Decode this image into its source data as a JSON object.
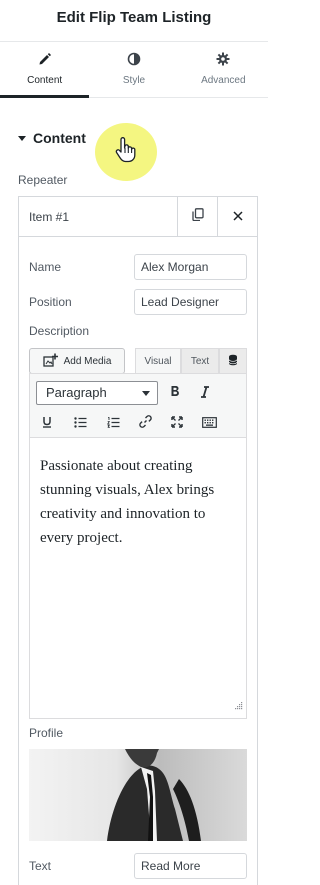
{
  "header": {
    "title": "Edit Flip Team Listing"
  },
  "tabs": [
    {
      "label": "Content",
      "icon": "pencil-icon",
      "active": true
    },
    {
      "label": "Style",
      "icon": "contrast-icon",
      "active": false
    },
    {
      "label": "Advanced",
      "icon": "gear-icon",
      "active": false
    }
  ],
  "section": {
    "title": "Content"
  },
  "repeater": {
    "label": "Repeater",
    "item": {
      "title": "Item #1",
      "fields": {
        "name": {
          "label": "Name",
          "value": "Alex Morgan"
        },
        "position": {
          "label": "Position",
          "value": "Lead Designer"
        },
        "description": {
          "label": "Description",
          "add_media": "Add Media",
          "tab_visual": "Visual",
          "tab_text": "Text",
          "format": "Paragraph",
          "content": "Passionate about creating stunning visuals, Alex brings creativity and innovation to every project."
        },
        "profile": {
          "label": "Profile"
        },
        "text": {
          "label": "Text",
          "value": "Read More"
        }
      }
    }
  },
  "colors": {
    "cursor_highlight": "#f3f57a",
    "active_tab_underline": "#1d2327"
  }
}
